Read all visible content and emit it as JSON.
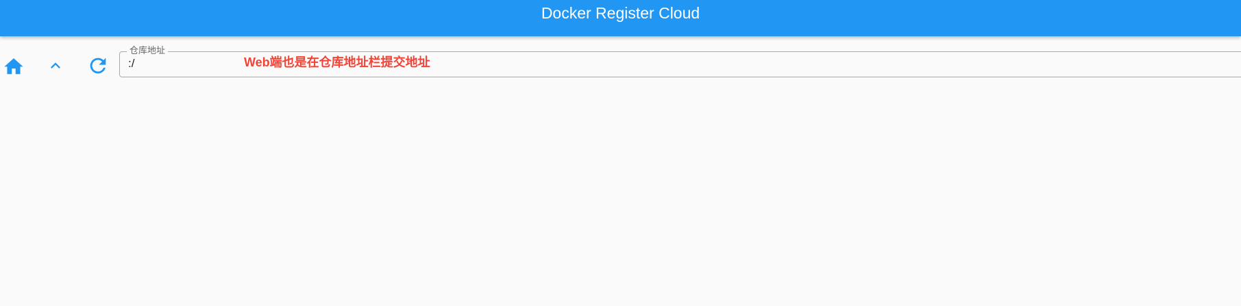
{
  "app_bar": {
    "title": "Docker Register Cloud"
  },
  "toolbar": {
    "icons": [
      "home-icon",
      "chevron-up-icon",
      "refresh-icon"
    ]
  },
  "address_field": {
    "label": "仓库地址",
    "value": ":/"
  },
  "annotation": {
    "text": "Web端也是在仓库地址栏提交地址"
  },
  "colors": {
    "primary": "#2196f3",
    "annotation": "#f44336",
    "background": "#fafafa"
  }
}
